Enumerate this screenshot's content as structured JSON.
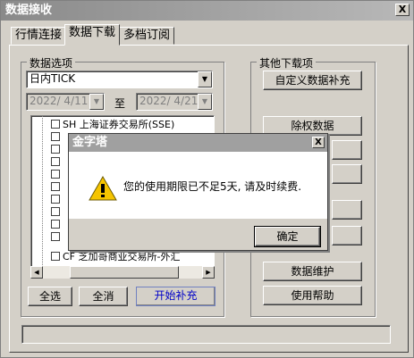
{
  "window": {
    "title": "数据接收",
    "close_glyph": "X"
  },
  "tabs": [
    {
      "label": "行情连接"
    },
    {
      "label": "数据下载"
    },
    {
      "label": "多档订阅"
    }
  ],
  "data_options": {
    "group_label": "数据选项",
    "type_select": {
      "value": "日内TICK",
      "arrow": "▼"
    },
    "date_from": "2022/ 4/11",
    "date_sep": "至",
    "date_to": "2022/ 4/21",
    "markets": [
      {
        "label": "SH 上海证券交易所(SSE)"
      },
      {
        "label": ""
      },
      {
        "label": ""
      },
      {
        "label": ""
      },
      {
        "label": ""
      },
      {
        "label": ""
      },
      {
        "label": ""
      },
      {
        "label": ""
      },
      {
        "label": ""
      },
      {
        "label": ""
      },
      {
        "label": "CF 芝加哥商业交易所-外汇"
      }
    ],
    "buttons": {
      "select_all": "全选",
      "clear_all": "全消",
      "start": "开始补充"
    }
  },
  "other_downloads": {
    "group_label": "其他下载项",
    "custom_supplement": "自定义数据补充",
    "exright": "除权数据",
    "maintenance": "数据维护",
    "help": "使用帮助"
  },
  "dialog": {
    "title": "金字塔",
    "close_glyph": "X",
    "message": "您的使用期限已不足5天, 请及时续费.",
    "ok_label": "确定",
    "icon": "warning-icon"
  }
}
